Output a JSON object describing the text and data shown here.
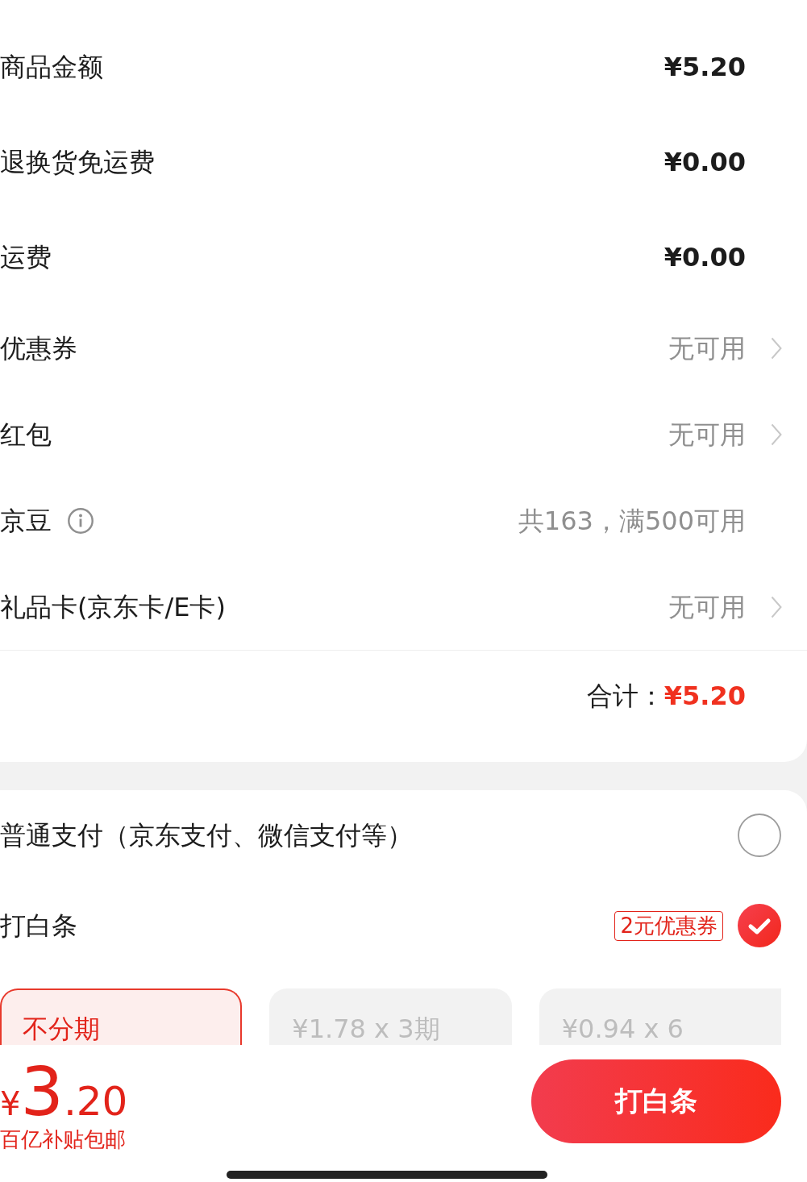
{
  "fee_rows": [
    {
      "label": "商品金额",
      "value": "¥5.20",
      "kind": "amount"
    },
    {
      "label": "退换货免运费",
      "value": "¥0.00",
      "kind": "amount"
    },
    {
      "label": "运费",
      "value": "¥0.00",
      "kind": "amount"
    },
    {
      "label": "优惠券",
      "value": "无可用",
      "kind": "link"
    },
    {
      "label": "红包",
      "value": "无可用",
      "kind": "link"
    },
    {
      "label": "京豆",
      "value": "共163，满500可用",
      "kind": "info"
    },
    {
      "label": "礼品卡(京东卡/E卡)",
      "value": "无可用",
      "kind": "link"
    }
  ],
  "total": {
    "label": "合计：",
    "value": "¥5.20"
  },
  "payment_methods": [
    {
      "label": "普通支付（京东支付、微信支付等）",
      "selected": false
    },
    {
      "label": "打白条",
      "badge": "2元优惠券",
      "selected": true
    }
  ],
  "installments": [
    {
      "label": "不分期",
      "selected": true
    },
    {
      "label": "¥1.78 x 3期",
      "selected": false
    },
    {
      "label": "¥0.94 x 6",
      "selected": false
    }
  ],
  "footer": {
    "price": "¥3.20",
    "note": "百亿补贴包邮",
    "button": "打白条"
  }
}
